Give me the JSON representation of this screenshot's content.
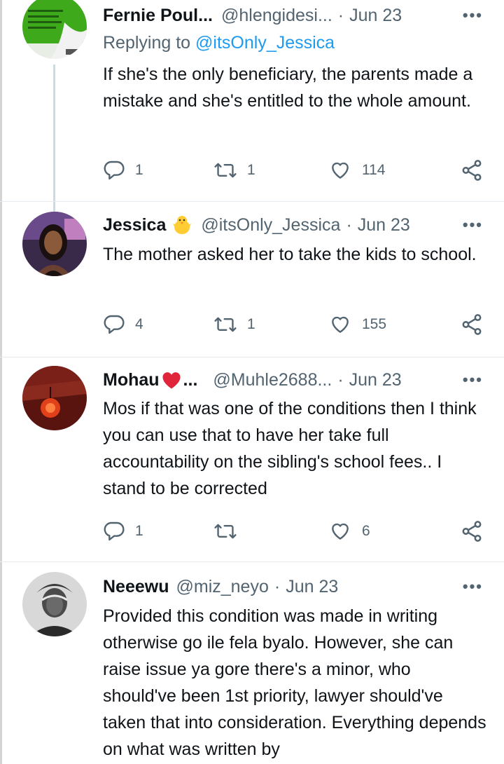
{
  "tweets": [
    {
      "name": "Fernie Poul...",
      "handle": "@hlengidesi...",
      "separator": "·",
      "date": "Jun 23",
      "more": "•••",
      "replying_prefix": "Replying to",
      "replying_to": "@itsOnly_Jessica",
      "text": "If she's the only beneficiary, the parents made a mistake and she's entitled to the whole amount.",
      "replies": "1",
      "retweets": "1",
      "likes": "114"
    },
    {
      "name": "Jessica",
      "emoji": "baby-chick-emoji",
      "handle": "@itsOnly_Jessica",
      "separator": "·",
      "date": "Jun 23",
      "more": "•••",
      "text": "The mother asked her to take the kids to school.",
      "replies": "4",
      "retweets": "1",
      "likes": "155"
    },
    {
      "name": "Mohau",
      "emoji": "red-heart-emoji",
      "name_suffix": "...",
      "handle": "@Muhle2688...",
      "separator": "·",
      "date": "Jun 23",
      "more": "•••",
      "text": "Mos if that was one of the conditions then I think you can use that to have her take full accountability on the sibling's school fees.. I stand to be corrected",
      "replies": "1",
      "retweets": "",
      "likes": "6"
    },
    {
      "name": "Neeewu",
      "handle": "@miz_neyo",
      "separator": "·",
      "date": "Jun 23",
      "more": "•••",
      "text": "Provided this condition was made in writing otherwise go ile fela byalo. However, she can raise issue ya gore there's a minor, who should've been 1st priority, lawyer should've taken that into consideration. Everything depends on what was written by"
    }
  ],
  "colors": {
    "text": "#0f1419",
    "secondary": "#536471",
    "link": "#1d9bf0",
    "divider": "#e6ecf0",
    "thread_line": "#cfd9de"
  }
}
